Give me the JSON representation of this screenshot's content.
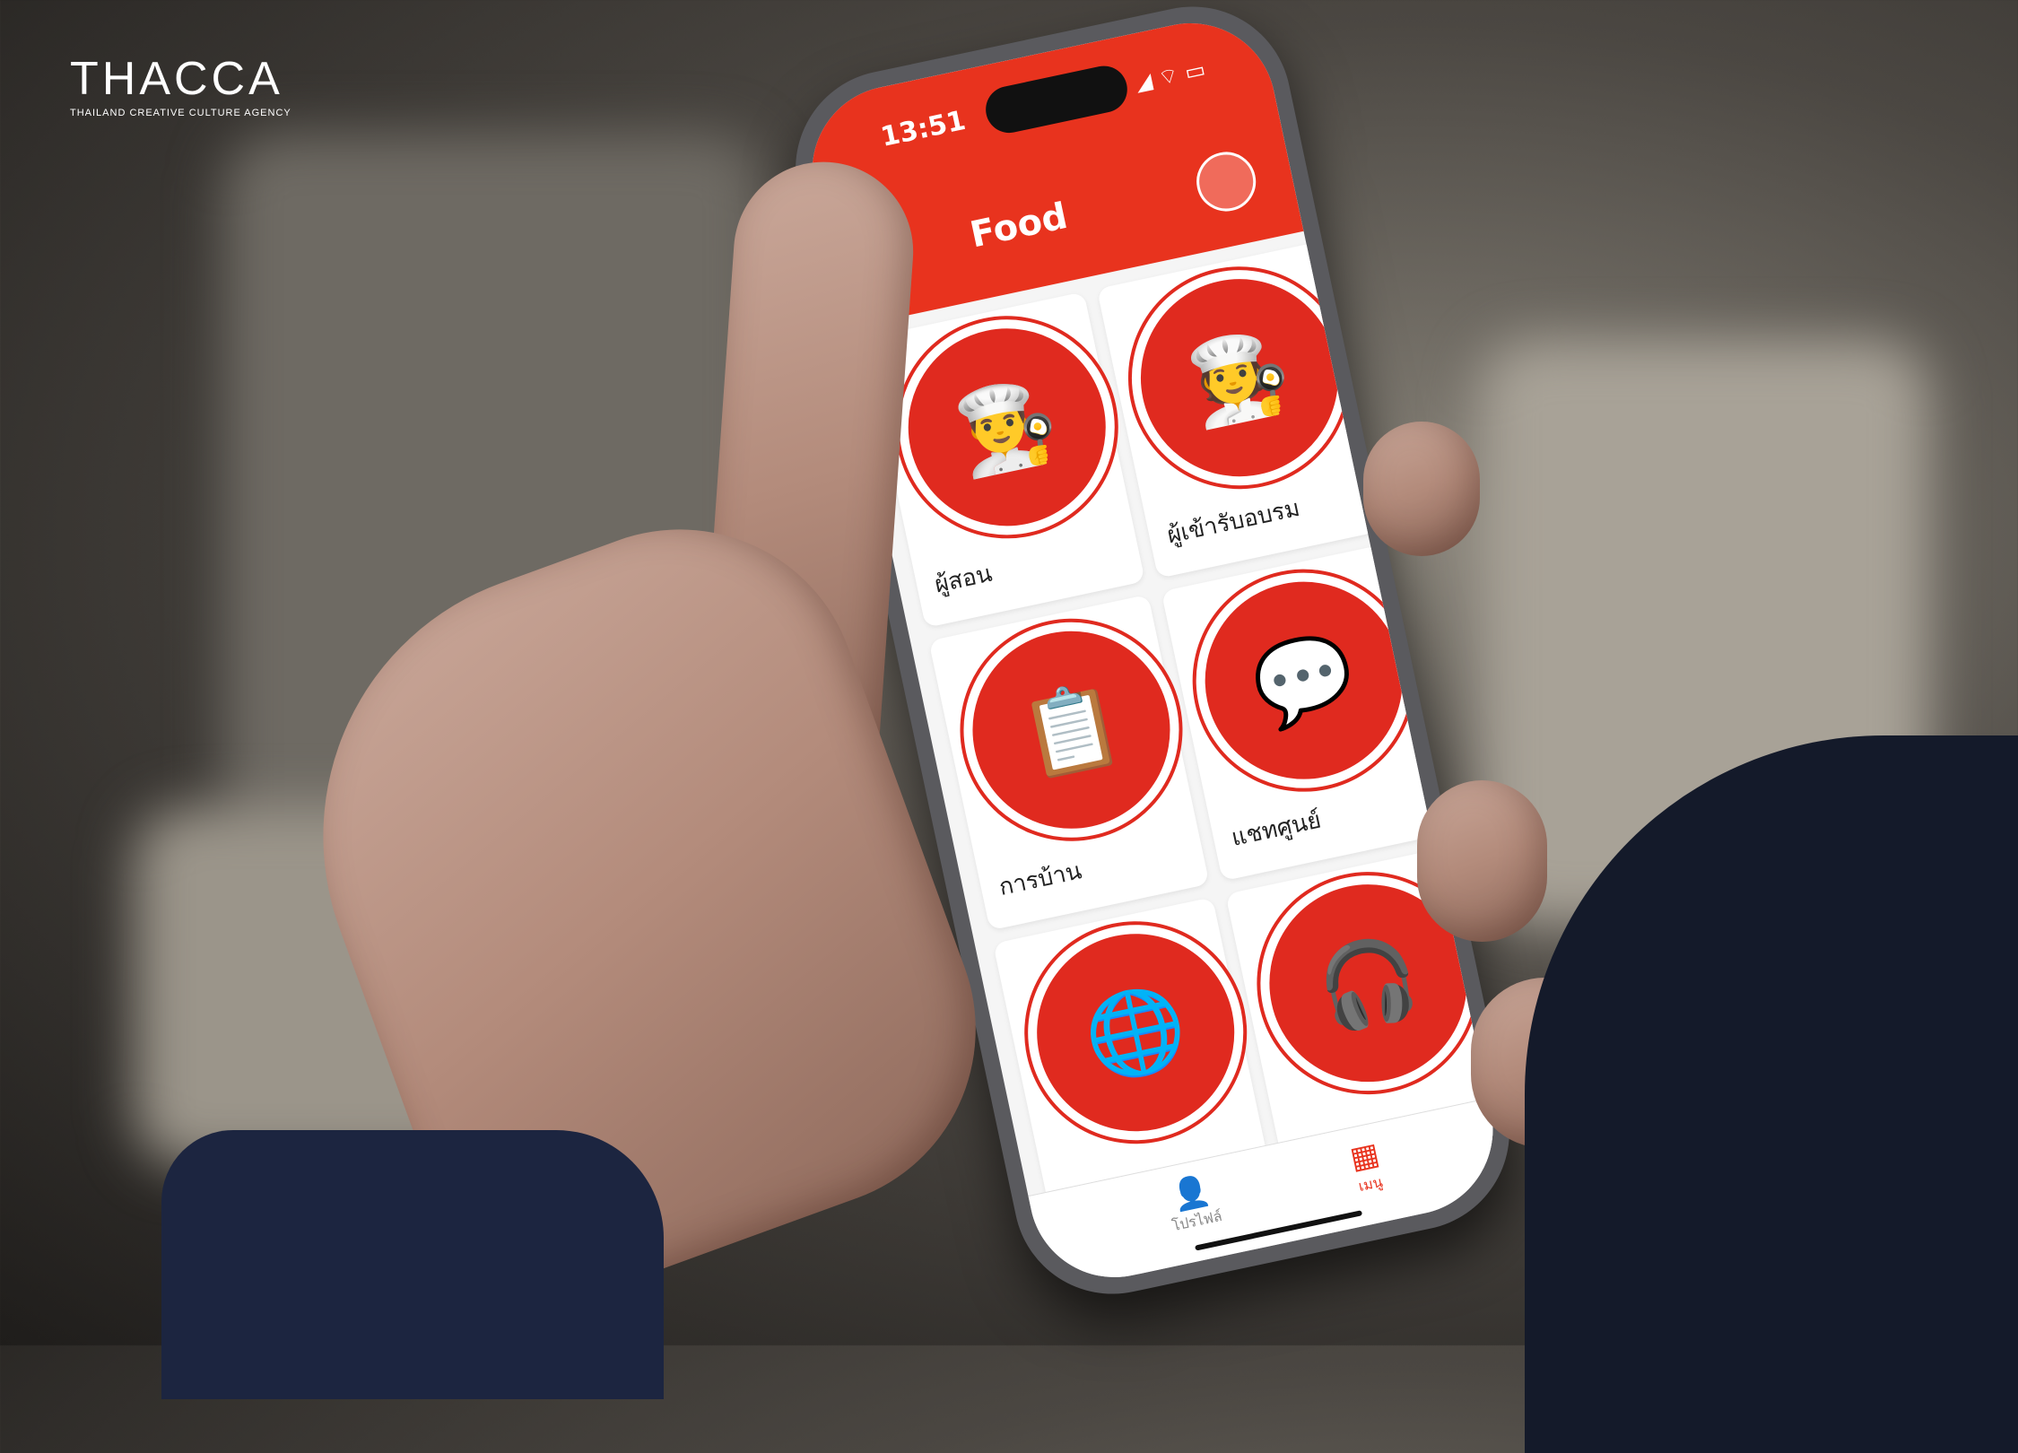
{
  "watermark": {
    "logo": "THACCA",
    "tagline": "THAILAND CREATIVE CULTURE AGENCY"
  },
  "phone": {
    "status_time": "13:51",
    "app_title": "Food",
    "tiles": [
      {
        "label": "ผู้สอน",
        "icon": "chef-icon"
      },
      {
        "label": "ผู้เข้ารับอบรม",
        "icon": "chef-trainees-icon"
      },
      {
        "label": "การบ้าน",
        "icon": "homework-checklist-icon"
      },
      {
        "label": "แชทศูนย์",
        "icon": "chat-bubble-icon"
      },
      {
        "label": "",
        "icon": "ebook-globe-icon"
      },
      {
        "label": "",
        "icon": "support-agent-icon"
      }
    ],
    "tabbar": {
      "profile_label": "โปรไฟล์",
      "menu_label": "เมนู"
    },
    "colors": {
      "primary": "#e8331e"
    }
  }
}
